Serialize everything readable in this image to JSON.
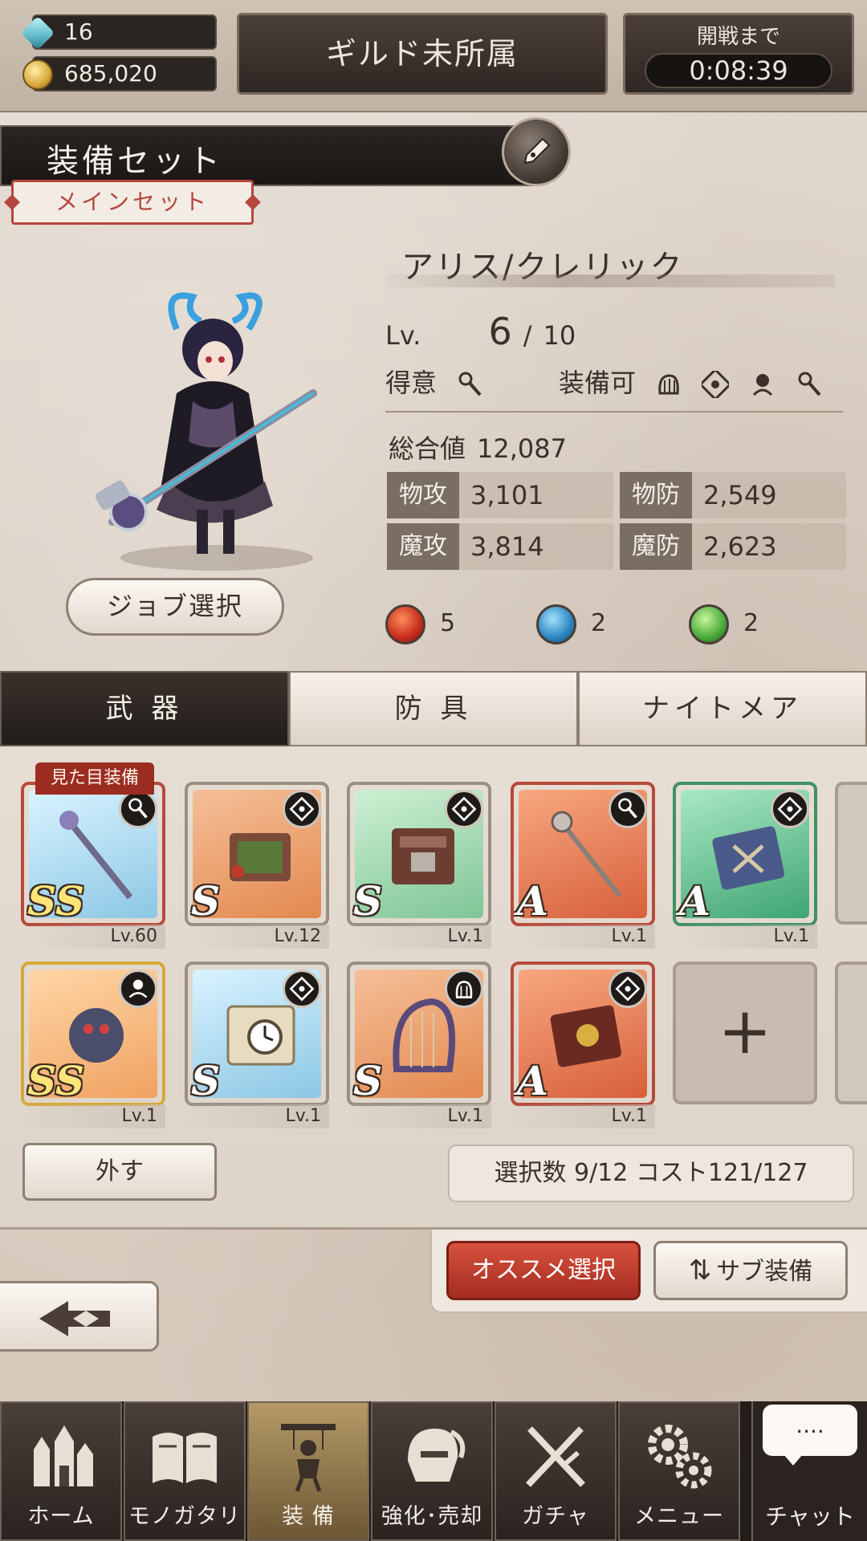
{
  "header": {
    "gems": "16",
    "coins": "685,020",
    "guild": "ギルド未所属",
    "battle_label": "開戦まで",
    "battle_time": "0:08:39"
  },
  "equip_set": {
    "title": "装備セット",
    "subtitle": "メインセット",
    "edit_icon": "pen-icon"
  },
  "character": {
    "name": "アリス/クレリック",
    "level_label": "Lv.",
    "level": "6",
    "level_max": "10",
    "specialty_label": "得意",
    "specialty_icons": [
      "staff-icon"
    ],
    "equippable_label": "装備可",
    "equippable_icons": [
      "harp-icon",
      "tome-icon",
      "orb-icon",
      "staff-icon"
    ],
    "total_label": "総合値",
    "total": "12,087",
    "stats": [
      {
        "key": "物攻",
        "value": "3,101"
      },
      {
        "key": "物防",
        "value": "2,549"
      },
      {
        "key": "魔攻",
        "value": "3,814"
      },
      {
        "key": "魔防",
        "value": "2,623"
      }
    ],
    "elements": [
      {
        "name": "fire",
        "count": "5"
      },
      {
        "name": "water",
        "count": "2"
      },
      {
        "name": "wind",
        "count": "2"
      }
    ],
    "job_button": "ジョブ選択"
  },
  "tabs": [
    {
      "label": "武 器",
      "active": true
    },
    {
      "label": "防 具",
      "active": false
    },
    {
      "label": "ナイトメア",
      "active": false
    }
  ],
  "items": {
    "looks_badge": "見た目装備",
    "row1": [
      {
        "rank": "SS",
        "level": "Lv.60",
        "type": "staff",
        "bg": "sky"
      },
      {
        "rank": "S",
        "level": "Lv.12",
        "type": "tome",
        "bg": "orange"
      },
      {
        "rank": "S",
        "level": "Lv.1",
        "type": "tome",
        "bg": "green"
      },
      {
        "rank": "A",
        "level": "Lv.1",
        "type": "staff",
        "bg": "red"
      },
      {
        "rank": "A",
        "level": "Lv.1",
        "type": "tome",
        "bg": "teal"
      }
    ],
    "row2": [
      {
        "rank": "SS",
        "level": "Lv.1",
        "type": "orb",
        "bg": "gold"
      },
      {
        "rank": "S",
        "level": "Lv.1",
        "type": "tome",
        "bg": "sky"
      },
      {
        "rank": "S",
        "level": "Lv.1",
        "type": "harp",
        "bg": "orange"
      },
      {
        "rank": "A",
        "level": "Lv.1",
        "type": "tome",
        "bg": "red"
      }
    ],
    "add_label": "+",
    "remove_button": "外す",
    "selection": "選択数 9/12  コスト121/127"
  },
  "actions": {
    "recommend": "オススメ選択",
    "sub_equip": "サブ装備"
  },
  "nav": [
    {
      "label": "ホーム",
      "icon": "castle-icon",
      "active": false
    },
    {
      "label": "モノガタリ",
      "icon": "book-icon",
      "active": false
    },
    {
      "label": "装 備",
      "icon": "puppet-icon",
      "active": true
    },
    {
      "label": "強化･売却",
      "icon": "helmet-icon",
      "active": false
    },
    {
      "label": "ガチャ",
      "icon": "swords-icon",
      "active": false
    },
    {
      "label": "メニュー",
      "icon": "gears-icon",
      "active": false
    }
  ],
  "chat": {
    "bubble": "....",
    "label": "チャット"
  }
}
